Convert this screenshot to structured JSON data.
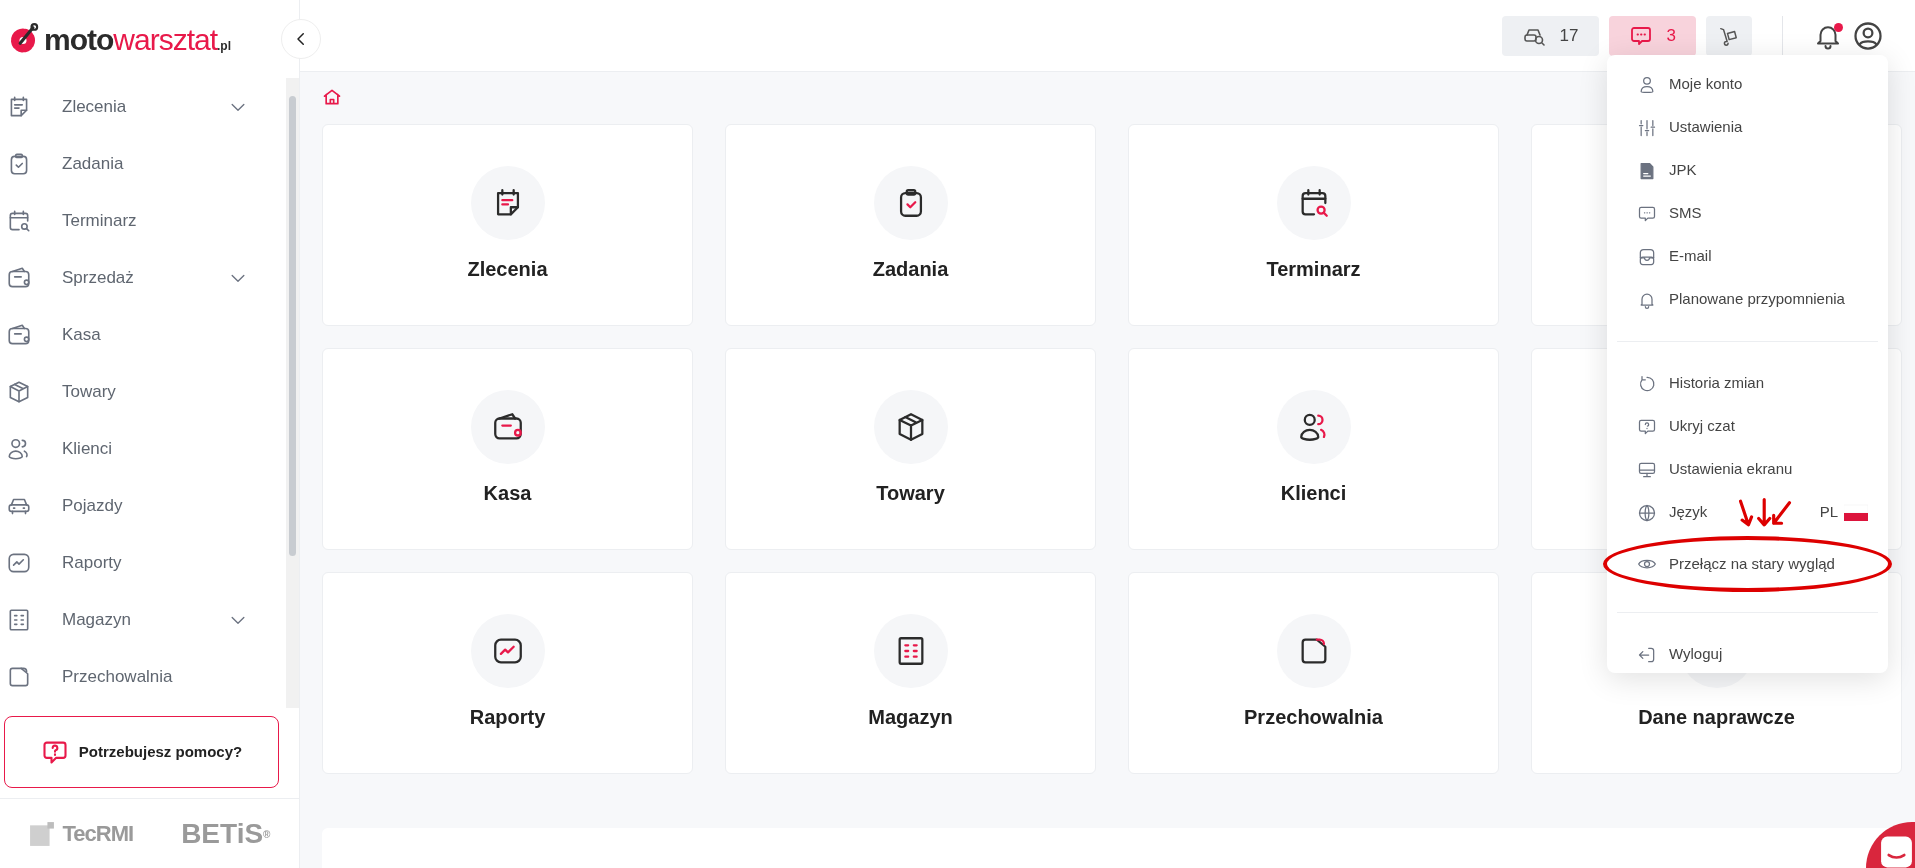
{
  "logo": {
    "text_dark": "moto",
    "text_accent": "warsztat",
    "suffix": ".pl"
  },
  "sidebar": {
    "items": [
      {
        "label": "Zlecenia",
        "expandable": true
      },
      {
        "label": "Zadania",
        "expandable": false
      },
      {
        "label": "Terminarz",
        "expandable": false
      },
      {
        "label": "Sprzedaż",
        "expandable": true
      },
      {
        "label": "Kasa",
        "expandable": false
      },
      {
        "label": "Towary",
        "expandable": false
      },
      {
        "label": "Klienci",
        "expandable": false
      },
      {
        "label": "Pojazdy",
        "expandable": false
      },
      {
        "label": "Raporty",
        "expandable": false
      },
      {
        "label": "Magazyn",
        "expandable": true
      },
      {
        "label": "Przechowalnia",
        "expandable": false
      }
    ],
    "help": "Potrzebujesz pomocy?",
    "partners": [
      {
        "name": "TecRMI"
      },
      {
        "name": "BETiS",
        "mark": "®"
      }
    ]
  },
  "topbar": {
    "buttons": [
      {
        "kind": "count",
        "count": "17",
        "highlighted": false
      },
      {
        "kind": "count",
        "count": "3",
        "highlighted": true
      },
      {
        "kind": "icon",
        "highlighted": false
      }
    ],
    "notifications_unread": true
  },
  "card_rows": [
    {
      "cards": [
        {
          "title": "Zlecenia"
        },
        {
          "title": "Zadania"
        },
        {
          "title": "Terminarz"
        }
      ]
    },
    {
      "cards": [
        {
          "title": "Kasa"
        },
        {
          "title": "Towary"
        },
        {
          "title": "Klienci"
        }
      ]
    },
    {
      "cards": [
        {
          "title": "Raporty"
        },
        {
          "title": "Magazyn"
        },
        {
          "title": "Przechowalnia"
        },
        {
          "title": "Dane naprawcze"
        }
      ]
    }
  ],
  "user_menu": {
    "groups": [
      [
        {
          "label": "Moje konto"
        },
        {
          "label": "Ustawienia"
        },
        {
          "label": "JPK"
        },
        {
          "label": "SMS"
        },
        {
          "label": "E-mail"
        },
        {
          "label": "Planowane przypomnienia"
        }
      ],
      [
        {
          "label": "Historia zmian"
        },
        {
          "label": "Ukryj czat"
        },
        {
          "label": "Ustawienia ekranu"
        },
        {
          "label": "Język",
          "value": "PL"
        },
        {
          "label": "Przełącz na stary wygląd",
          "circled": true
        }
      ],
      [
        {
          "label": "Wyloguj"
        }
      ]
    ]
  }
}
